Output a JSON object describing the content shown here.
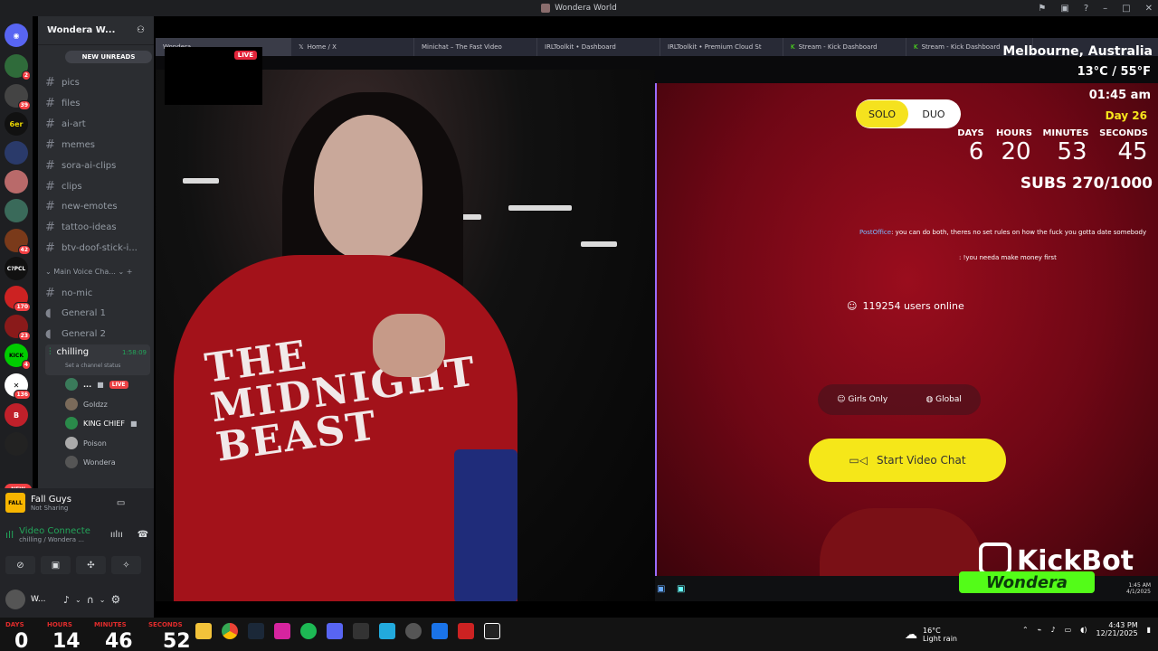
{
  "window": {
    "title": "Wondera World"
  },
  "server_rail": {
    "badges": [
      "2",
      "39",
      "42",
      "170",
      "23",
      "4",
      "136"
    ],
    "items": [
      "C?PCL",
      "KICK"
    ],
    "new_label": "NEW"
  },
  "sidebar": {
    "guild_name": "Wondera W...",
    "new_unreads": "NEW UNREADS",
    "channels": [
      "pics",
      "files",
      "ai-art",
      "memes",
      "sora-ai-clips",
      "clips",
      "new-emotes",
      "tattoo-ideas",
      "btv-doof-stick-i..."
    ],
    "voice_category": "Main Voice Cha...",
    "voice_channels": [
      "no-mic",
      "General 1",
      "General 2"
    ],
    "active_voice": {
      "name": "chilling",
      "timer": "1:58:09",
      "status": "Set a channel status"
    },
    "voice_users": [
      {
        "name": "...",
        "live": "LIVE"
      },
      {
        "name": "Goldzz"
      },
      {
        "name": "KING CHIEF"
      },
      {
        "name": "Poison"
      },
      {
        "name": "Wondera"
      }
    ]
  },
  "panel": {
    "game_title": "Fall Guys",
    "game_status": "Not Sharing",
    "game_icon": "FALL",
    "voice_connected": "Video Connecte",
    "voice_channel": "chilling / Wondera ...",
    "user_name": "W..."
  },
  "browser_tabs": [
    "Wondera",
    "Home / X",
    "Minichat – The Fast Video",
    "IRLToolkit • Dashboard",
    "IRLToolkit • Premium Cloud St",
    "Stream - Kick Dashboard",
    "Stream - Kick Dashboard"
  ],
  "stream": {
    "live_tag": "LIVE",
    "hoodie_text": "THE MIDNIGHT BEAST",
    "mode_solo": "SOLO",
    "mode_duo": "DUO",
    "users_online": "119254 users online",
    "filter_girls": "Girls Only",
    "filter_global": "Global",
    "start_button": "Start Video Chat",
    "chat": [
      {
        "user": "PostOffice",
        "text": ": you can do both, theres no set rules on how the fuck you gotta date somebody"
      },
      {
        "user": "",
        "text": ": !you needa make money first"
      }
    ]
  },
  "overlay": {
    "location": "Melbourne, Australia",
    "temperature": "13°C / 55°F",
    "time": "01:45 am",
    "day": "Day 26",
    "countdown_labels": [
      "DAYS",
      "HOURS",
      "MINUTES",
      "SECONDS"
    ],
    "countdown_values": [
      "6",
      "20",
      "53",
      "45"
    ],
    "subs": "SUBS 270/1000"
  },
  "kickbot": {
    "title": "KickBot",
    "subtitle": "Wondera"
  },
  "inner_taskbar": {
    "time": "1:45 AM",
    "date": "4/1/2025"
  },
  "taskbar": {
    "countdown_labels": [
      "DAYS",
      "HOURS",
      "MINUTES",
      "SECONDS"
    ],
    "countdown_values": [
      "0",
      "14",
      "46",
      "52"
    ],
    "weather_temp": "16°C",
    "weather_desc": "Light rain",
    "clock_time": "4:43 PM",
    "clock_date": "12/21/2025"
  },
  "colors": {
    "discord_bg": "#2b2d31",
    "rail_bg": "#1e1f22",
    "accent_yellow": "#f5e719",
    "kick_green": "#53fc18",
    "live_red": "#e3253b"
  }
}
